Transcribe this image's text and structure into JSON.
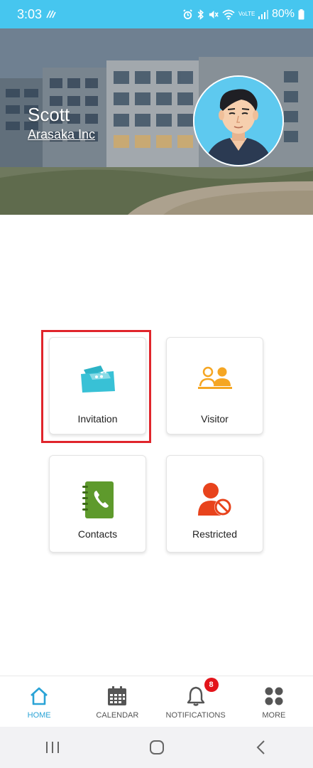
{
  "status_bar": {
    "time": "3:03",
    "battery": "80%",
    "network_label": "VoLTE"
  },
  "profile": {
    "name": "Scott",
    "company": "Arasaka Inc"
  },
  "tiles": [
    {
      "label": "Invitation",
      "icon": "tickets-icon",
      "color": "#38c1d6",
      "highlighted": true
    },
    {
      "label": "Visitor",
      "icon": "visitor-icon",
      "color": "#f5a623",
      "highlighted": false
    },
    {
      "label": "Contacts",
      "icon": "phone-book-icon",
      "color": "#5e9a2c",
      "highlighted": false
    },
    {
      "label": "Restricted",
      "icon": "restricted-user-icon",
      "color": "#e8431c",
      "highlighted": false
    }
  ],
  "bottom_nav": {
    "items": [
      {
        "label": "HOME",
        "icon": "home-icon",
        "active": true
      },
      {
        "label": "CALENDAR",
        "icon": "calendar-icon",
        "active": false
      },
      {
        "label": "NOTIFICATIONS",
        "icon": "bell-icon",
        "active": false,
        "badge": "8"
      },
      {
        "label": "MORE",
        "icon": "grid-icon",
        "active": false
      }
    ]
  },
  "colors": {
    "status_bar": "#46c6ef",
    "accent": "#2aa3d6",
    "highlight": "#e0252b",
    "badge": "#e3141b"
  }
}
